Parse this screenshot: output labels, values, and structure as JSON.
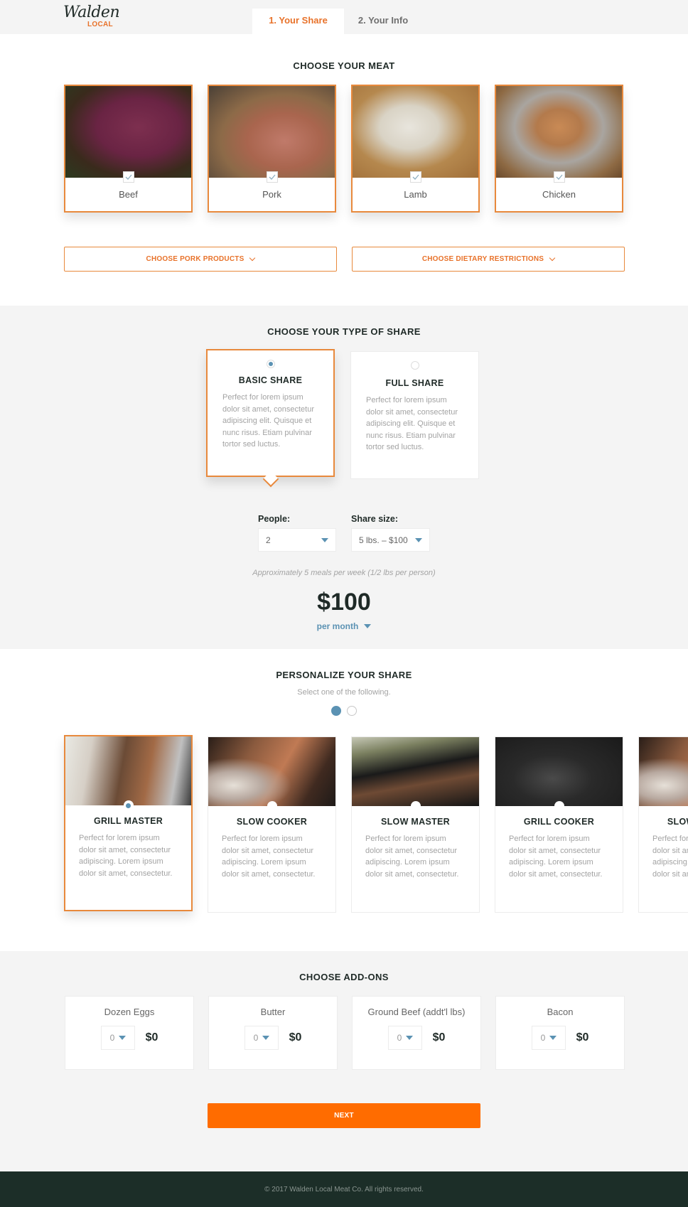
{
  "header": {
    "logo_script": "Walden",
    "logo_sub": "LOCAL",
    "tabs": [
      {
        "label": "1. Your Share",
        "active": true
      },
      {
        "label": "2. Your Info",
        "active": false
      }
    ]
  },
  "meat": {
    "title": "CHOOSE YOUR MEAT",
    "items": [
      {
        "label": "Beef",
        "checked": true,
        "icon": "check-icon"
      },
      {
        "label": "Pork",
        "checked": true,
        "icon": "check-icon"
      },
      {
        "label": "Lamb",
        "checked": true,
        "icon": "check-icon"
      },
      {
        "label": "Chicken",
        "checked": true,
        "icon": "check-icon"
      }
    ],
    "pork_products_label": "CHOOSE PORK PRODUCTS",
    "dietary_label": "CHOOSE DIETARY RESTRICTIONS"
  },
  "share": {
    "title": "CHOOSE YOUR TYPE OF SHARE",
    "options": [
      {
        "name": "BASIC SHARE",
        "selected": true,
        "description": "Perfect for lorem ipsum dolor sit amet, consectetur adipiscing elit. Quisque et nunc risus. Etiam pulvinar tortor sed luctus."
      },
      {
        "name": "FULL SHARE",
        "selected": false,
        "description": "Perfect for lorem ipsum dolor sit amet, consectetur adipiscing elit. Quisque et nunc risus. Etiam pulvinar tortor sed luctus."
      }
    ],
    "people_label": "People:",
    "people_value": "2",
    "size_label": "Share size:",
    "size_value": "5 lbs. – $100",
    "approx_note": "Approximately 5 meals per week (1/2 lbs per person)",
    "price": "$100",
    "period": "per month"
  },
  "personalize": {
    "title": "PERSONALIZE YOUR SHARE",
    "subtitle": "Select one of the following.",
    "page_count": 2,
    "current_page": 1,
    "options": [
      {
        "name": "GRILL MASTER",
        "selected": true,
        "description": "Perfect for lorem ipsum dolor sit amet, consectetur adipiscing. Lorem ipsum dolor sit amet, consectetur."
      },
      {
        "name": "SLOW COOKER",
        "selected": false,
        "description": "Perfect for lorem ipsum dolor sit amet, consectetur adipiscing. Lorem ipsum dolor sit amet, consectetur."
      },
      {
        "name": "SLOW MASTER",
        "selected": false,
        "description": "Perfect for lorem ipsum dolor sit amet, consectetur adipiscing. Lorem ipsum dolor sit amet, consectetur."
      },
      {
        "name": "GRILL COOKER",
        "selected": false,
        "description": "Perfect for lorem ipsum dolor sit amet, consectetur adipiscing. Lorem ipsum dolor sit amet, consectetur."
      },
      {
        "name": "SLOW COOKER",
        "selected": false,
        "description": "Perfect for lorem ipsum dolor sit amet, consectetur adipiscing. Lorem ipsum dolor sit amet, consectetur."
      }
    ]
  },
  "addons": {
    "title": "CHOOSE ADD-ONS",
    "items": [
      {
        "name": "Dozen Eggs",
        "qty": "0",
        "price": "$0"
      },
      {
        "name": "Butter",
        "qty": "0",
        "price": "$0"
      },
      {
        "name": "Ground Beef (addt'l lbs)",
        "qty": "0",
        "price": "$0"
      },
      {
        "name": "Bacon",
        "qty": "0",
        "price": "$0"
      }
    ],
    "next_label": "NEXT"
  },
  "footer": {
    "copyright": "© 2017 Walden Local Meat Co. All rights reserved."
  },
  "colors": {
    "accent_orange": "#e8893c",
    "button_orange": "#ff6c00",
    "accent_blue": "#5b92b3",
    "footer_bg": "#1c2e28"
  }
}
